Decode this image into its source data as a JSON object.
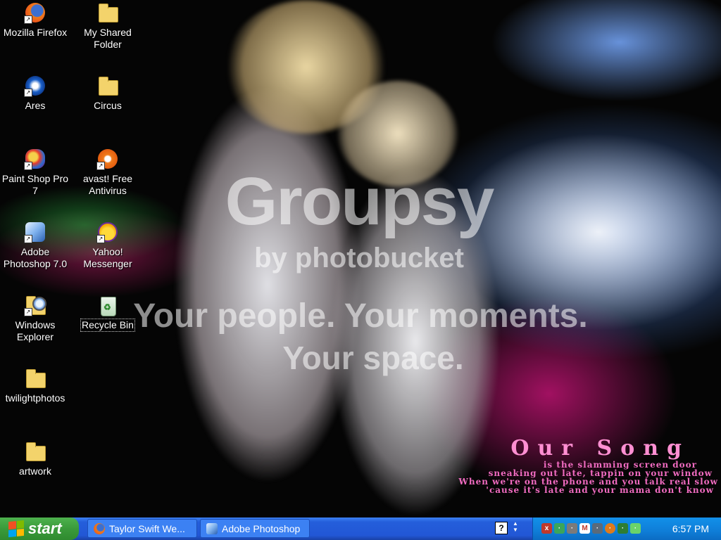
{
  "wallpaper": {
    "watermark_logo": "Groupsy",
    "watermark_sub": "by photobucket",
    "watermark_tagline_1": "Your people. Your moments.",
    "watermark_tagline_2": "Your space.",
    "lyrics_title": "Our Song",
    "lyrics_lines": [
      "is the slamming screen door",
      "sneaking out late, tappin on your window",
      "When we're on the phone and you talk real slow",
      "'cause it's late and your mama don't know"
    ]
  },
  "desktop_icons": [
    {
      "label": "Mozilla Firefox",
      "icon": "firefox-icon",
      "selected": false
    },
    {
      "label": "My Shared Folder",
      "icon": "folder-icon",
      "selected": false
    },
    {
      "label": "Ares",
      "icon": "ares-icon",
      "selected": false
    },
    {
      "label": "Circus",
      "icon": "folder-icon",
      "selected": false
    },
    {
      "label": "Paint Shop Pro 7",
      "icon": "paint-shop-pro-icon",
      "selected": false
    },
    {
      "label": "avast! Free Antivirus",
      "icon": "avast-icon",
      "selected": false
    },
    {
      "label": "Adobe Photoshop 7.0",
      "icon": "photoshop-icon",
      "selected": false
    },
    {
      "label": "Yahoo! Messenger",
      "icon": "yahoo-messenger-icon",
      "selected": false
    },
    {
      "label": "Windows Explorer",
      "icon": "windows-explorer-icon",
      "selected": false
    },
    {
      "label": "Recycle Bin",
      "icon": "recycle-bin-icon",
      "selected": true
    },
    {
      "label": "twilightphotos",
      "icon": "folder-icon",
      "selected": false
    },
    {
      "label": "artwork",
      "icon": "folder-icon",
      "selected": false
    }
  ],
  "taskbar": {
    "start_label": "start",
    "tasks": [
      {
        "label": "Taylor Swift We...",
        "icon": "firefox-icon"
      },
      {
        "label": "Adobe Photoshop",
        "icon": "photoshop-icon"
      }
    ],
    "help_glyph": "?",
    "tray_icons": [
      "close-x-icon",
      "network-icon",
      "antivirus-icon",
      "gmail-icon",
      "volume-icon",
      "ares-tray-icon",
      "shield-icon",
      "signal-icon"
    ],
    "clock": "6:57 PM"
  },
  "colors": {
    "taskbar": "#245edb",
    "start_button": "#3a9a3a",
    "tray": "#0f7ed8",
    "lyrics": "#f06bc0"
  }
}
